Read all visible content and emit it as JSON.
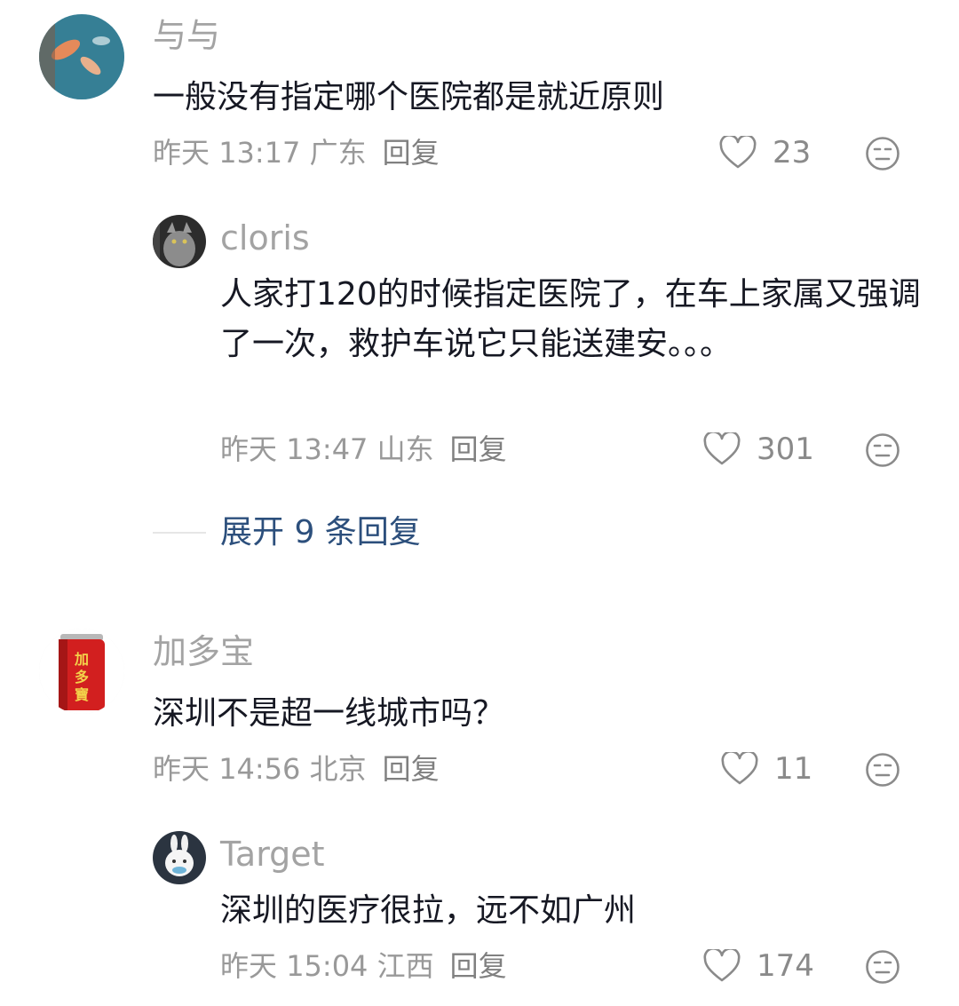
{
  "comments": [
    {
      "username": "与与",
      "content": "一般没有指定哪个医院都是就近原则",
      "date": "昨天",
      "time": "13:17",
      "region": "广东",
      "reply_label": "回复",
      "likes": "23"
    },
    {
      "username": "cloris",
      "content": "人家打120的时候指定医院了，在车上家属又强调了一次，救护车说它只能送建安。。。",
      "date": "昨天",
      "time": "13:47",
      "region": "山东",
      "reply_label": "回复",
      "likes": "301"
    },
    {
      "username": "加多宝",
      "content": "深圳不是超一线城市吗？",
      "date": "昨天",
      "time": "14:56",
      "region": "北京",
      "reply_label": "回复",
      "likes": "11"
    },
    {
      "username": "Target",
      "content": "深圳的医疗很拉，远不如广州",
      "date": "昨天",
      "time": "15:04",
      "region": "江西",
      "reply_label": "回复",
      "likes": "174"
    }
  ],
  "expand_replies": "展开 9 条回复"
}
